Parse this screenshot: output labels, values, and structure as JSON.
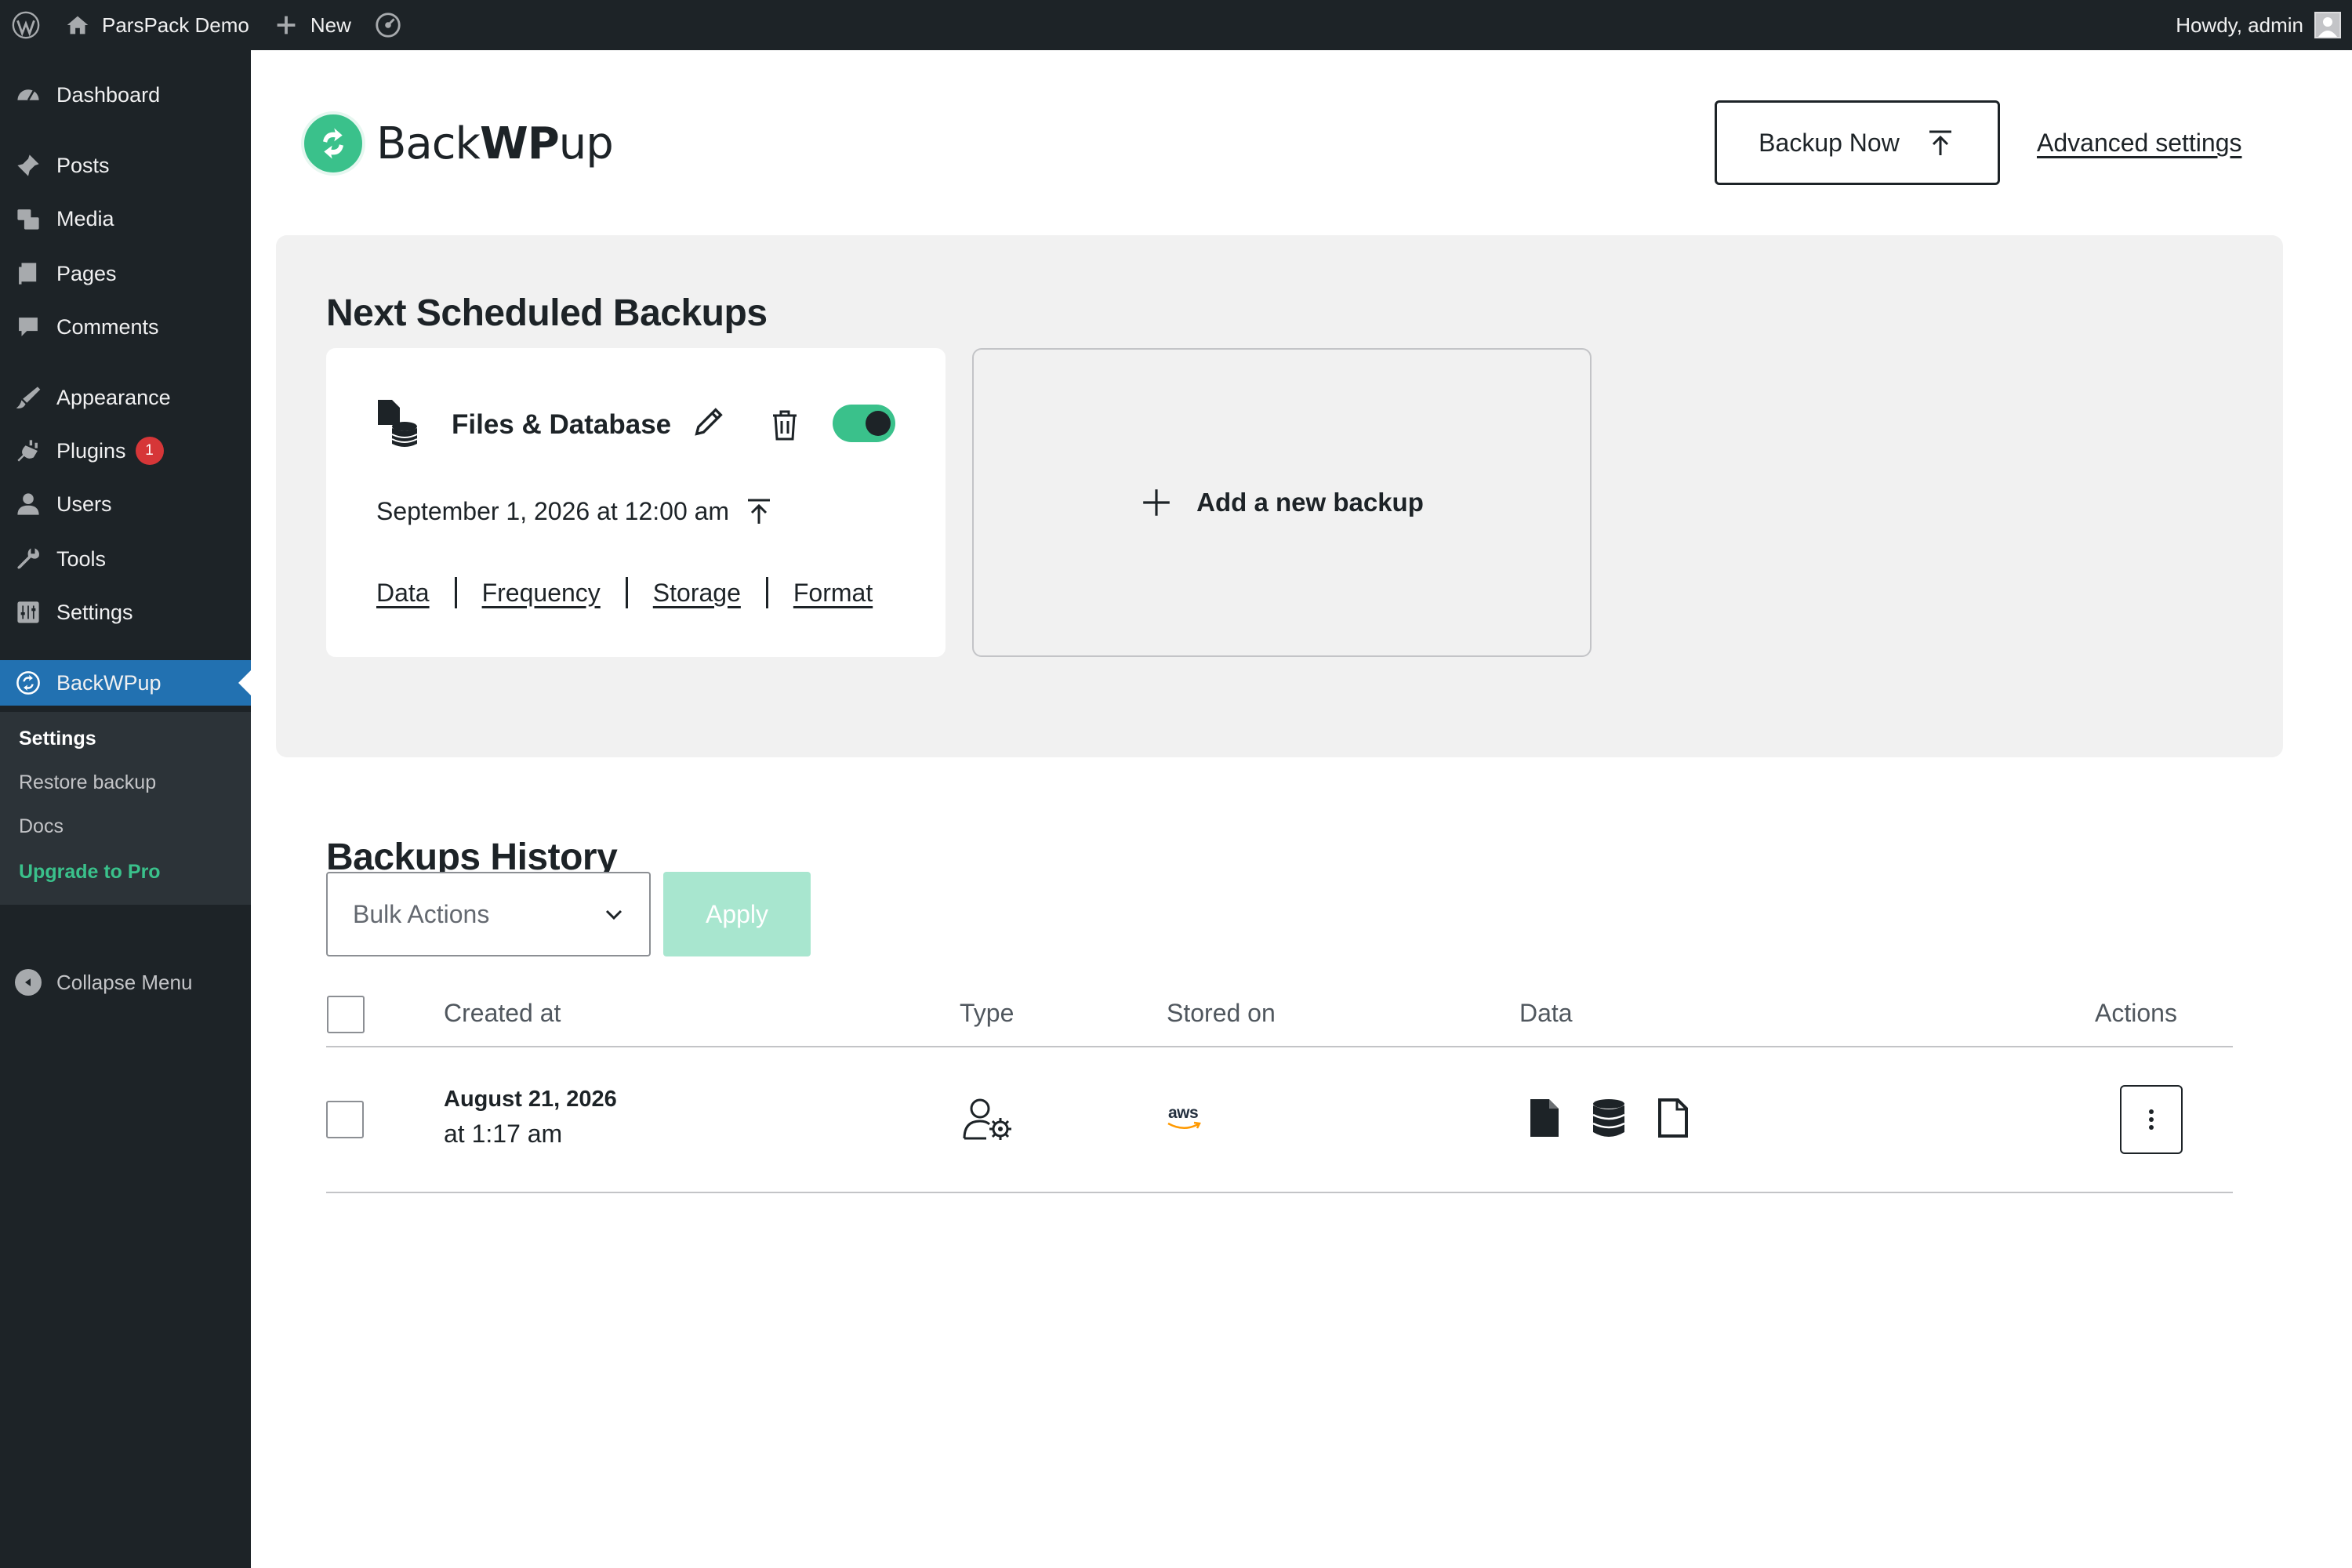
{
  "adminbar": {
    "site_name": "ParsPack Demo",
    "new_label": "New",
    "howdy": "Howdy, admin",
    "icons": [
      "wordpress-logo-icon",
      "home-icon",
      "plus-icon",
      "performance-icon",
      "avatar"
    ]
  },
  "sidebar": {
    "items": [
      {
        "label": "Dashboard",
        "icon": "dashboard-icon"
      },
      {
        "label": "Posts",
        "icon": "pin-icon"
      },
      {
        "label": "Media",
        "icon": "media-icon"
      },
      {
        "label": "Pages",
        "icon": "pages-icon"
      },
      {
        "label": "Comments",
        "icon": "comment-icon"
      },
      {
        "label": "Appearance",
        "icon": "brush-icon"
      },
      {
        "label": "Plugins",
        "icon": "plugin-icon",
        "badge": "1"
      },
      {
        "label": "Users",
        "icon": "user-icon"
      },
      {
        "label": "Tools",
        "icon": "wrench-icon"
      },
      {
        "label": "Settings",
        "icon": "settings-icon"
      },
      {
        "label": "BackWPup",
        "icon": "backwpup-icon",
        "current": true
      }
    ],
    "submenu": [
      "Settings",
      "Restore backup",
      "Docs",
      "Upgrade to Pro"
    ],
    "collapse": "Collapse Menu"
  },
  "header": {
    "logo_text_light": "Back",
    "logo_text_bold": "WP",
    "logo_text_tail": "up",
    "backup_now": "Backup Now",
    "advanced_settings": "Advanced settings"
  },
  "scheduled": {
    "title": "Next Scheduled Backups",
    "card": {
      "title": "Files & Database",
      "date": "September 1, 2026 at 12:00 am",
      "enabled": true,
      "links": [
        "Data",
        "Frequency",
        "Storage",
        "Format"
      ]
    },
    "add_new": "Add a new backup"
  },
  "history": {
    "title": "Backups History",
    "bulk_actions": "Bulk Actions",
    "apply": "Apply",
    "columns": [
      "Created at",
      "Type",
      "Stored on",
      "Data",
      "Actions"
    ],
    "rows": [
      {
        "date_line1": "August 21, 2026",
        "date_line2": "at 1:17 am",
        "type_icon": "user-gear-icon",
        "stored_on": "aws",
        "data_icons": [
          "file-icon",
          "database-icon",
          "file-outline-icon"
        ]
      }
    ]
  },
  "colors": {
    "accent": "#3ac18b",
    "wp_blue": "#2271b1",
    "dark": "#1d2327",
    "badge": "#d63638"
  }
}
